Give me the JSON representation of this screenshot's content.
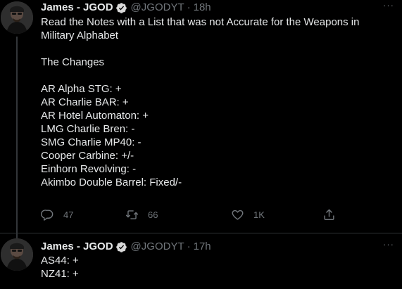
{
  "colors": {
    "background": "#000000",
    "text": "#e7e9ea",
    "secondary": "#71767b",
    "verified": "#d9d9d9",
    "divider": "#2f3336"
  },
  "tweets": [
    {
      "author": {
        "name": "James - JGOD",
        "handle": "@JGODYT",
        "verified": true,
        "verified_icon": "verified-badge-icon"
      },
      "separator": "·",
      "time": "18h",
      "more_icon": "more-horizontal-icon",
      "more_label": "···",
      "text_lines": [
        "Read the Notes with a List that was not Accurate for the Weapons in",
        "Military Alphabet",
        "",
        "The Changes",
        "",
        "AR Alpha STG: +",
        "AR Charlie BAR: +",
        "AR Hotel Automaton: +",
        "LMG Charlie Bren: -",
        "SMG Charlie MP40: -",
        "Cooper Carbine: +/-",
        "Einhorn Revolving: -",
        "Akimbo Double Barrel: Fixed/-"
      ],
      "actions": {
        "reply": {
          "icon": "reply-icon",
          "count": "47"
        },
        "retweet": {
          "icon": "retweet-icon",
          "count": "66"
        },
        "like": {
          "icon": "heart-icon",
          "count": "1K"
        },
        "share": {
          "icon": "share-icon"
        }
      }
    },
    {
      "author": {
        "name": "James - JGOD",
        "handle": "@JGODYT",
        "verified": true,
        "verified_icon": "verified-badge-icon"
      },
      "separator": "·",
      "time": "17h",
      "more_icon": "more-horizontal-icon",
      "more_label": "···",
      "text_lines": [
        "AS44: +",
        "NZ41: +"
      ]
    }
  ]
}
